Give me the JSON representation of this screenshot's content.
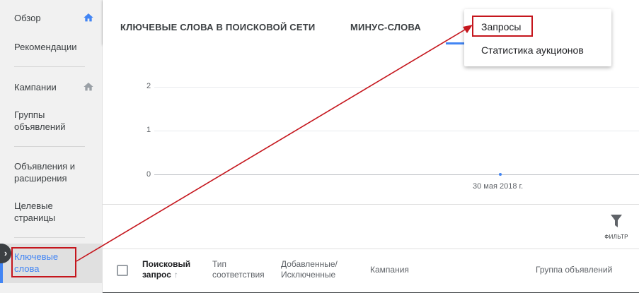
{
  "sidebar": {
    "items": [
      {
        "label": "Обзор"
      },
      {
        "label": "Рекомендации"
      },
      {
        "label": "Кампании"
      },
      {
        "label": "Группы объявлений"
      },
      {
        "label": "Объявления и расширения"
      },
      {
        "label": "Целевые страницы"
      },
      {
        "label": "Ключевые слова"
      }
    ],
    "active_color": "#4285f4"
  },
  "tabs": [
    {
      "label": "КЛЮЧЕВЫЕ СЛОВА В ПОИСКОВОЙ СЕТИ"
    },
    {
      "label": "МИНУС-СЛОВА"
    }
  ],
  "menu": {
    "items": [
      {
        "label": "Запросы"
      },
      {
        "label": "Статистика аукционов"
      }
    ]
  },
  "chart_data": {
    "type": "line",
    "title": "",
    "xlabel": "",
    "ylabel": "",
    "yticks": [
      "2",
      "1",
      "0"
    ],
    "ylim": [
      0,
      2
    ],
    "x": [
      "30 мая 2018 г."
    ],
    "series": [
      {
        "values": [
          0
        ]
      }
    ],
    "grid": true,
    "color": "#4285f4"
  },
  "filter": {
    "label": "ФИЛЬТР",
    "icon": "filter-icon"
  },
  "table": {
    "headers": [
      {
        "label": "Поисковый запрос",
        "sort_icon": "↑"
      },
      {
        "label": "Тип соответствия"
      },
      {
        "label": "Добавленные/ Исключенные"
      },
      {
        "label": "Кампания"
      },
      {
        "label": "Группа объявлений"
      }
    ]
  },
  "annotation_color": "#c5161d"
}
